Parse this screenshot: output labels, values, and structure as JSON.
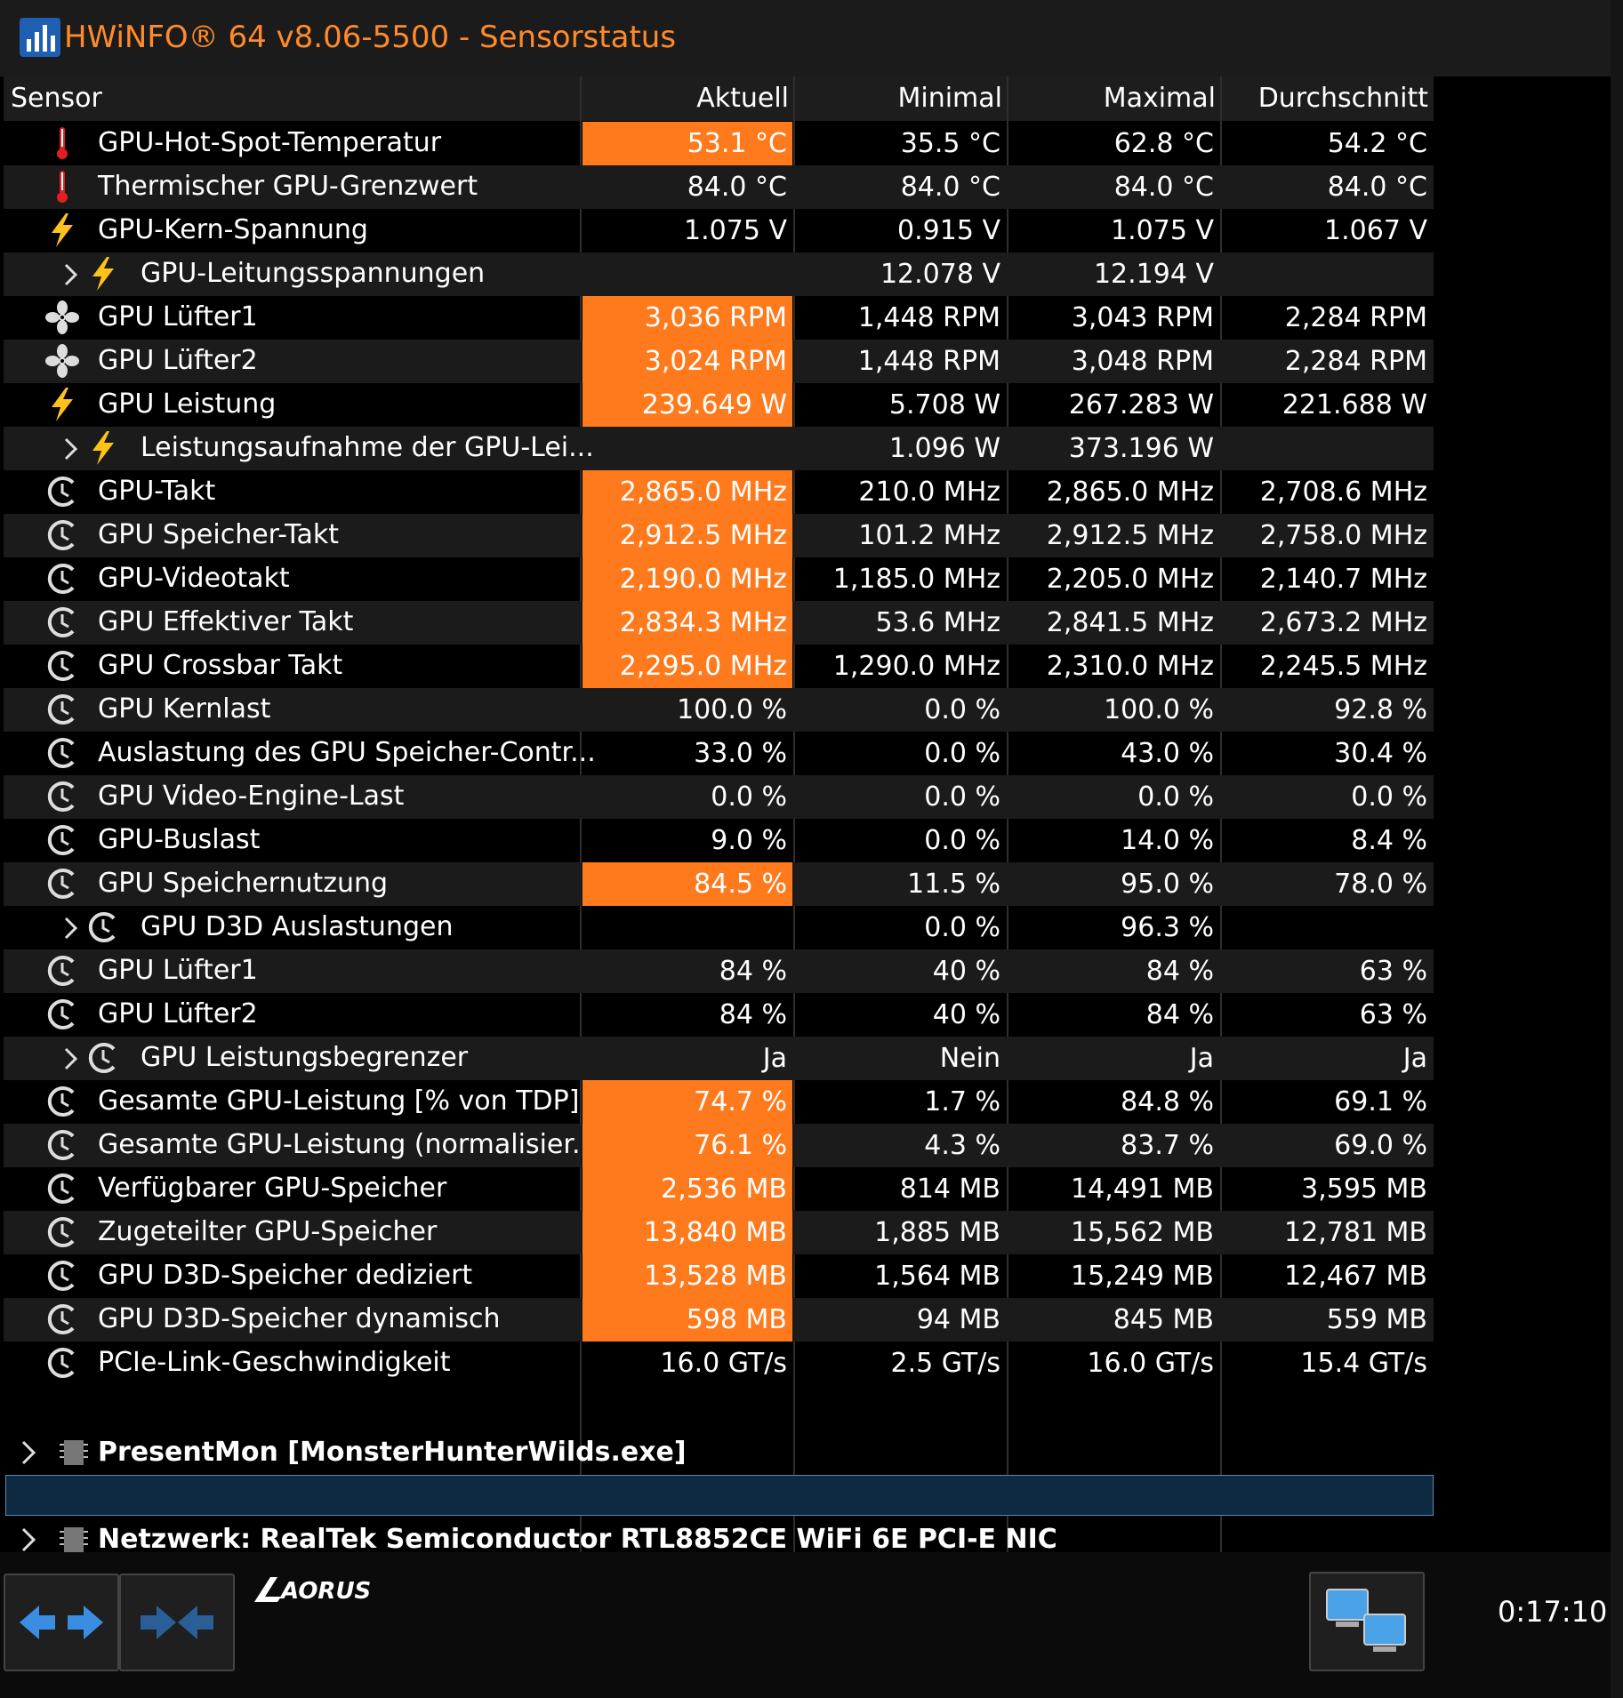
{
  "window": {
    "title": "HWiNFO® 64 v8.06-5500 - Sensorstatus"
  },
  "columns": [
    "Sensor",
    "Aktuell",
    "Minimal",
    "Maximal",
    "Durchschnitt"
  ],
  "rows": [
    {
      "icon": "thermometer-icon",
      "name": "GPU-Hot-Spot-Temperatur",
      "cur": "53.1 °C",
      "min": "35.5 °C",
      "max": "62.8 °C",
      "avg": "54.2 °C",
      "hl": true
    },
    {
      "icon": "thermometer-icon",
      "name": "Thermischer GPU-Grenzwert",
      "cur": "84.0 °C",
      "min": "84.0 °C",
      "max": "84.0 °C",
      "avg": "84.0 °C"
    },
    {
      "icon": "lightning-icon",
      "name": "GPU-Kern-Spannung",
      "cur": "1.075 V",
      "min": "0.915 V",
      "max": "1.075 V",
      "avg": "1.067 V"
    },
    {
      "icon": "lightning-icon",
      "name": "GPU-Leitungsspannungen",
      "cur": "",
      "min": "12.078 V",
      "max": "12.194 V",
      "avg": "",
      "sub": true
    },
    {
      "icon": "fan-icon",
      "name": "GPU Lüfter1",
      "cur": "3,036 RPM",
      "min": "1,448 RPM",
      "max": "3,043 RPM",
      "avg": "2,284 RPM",
      "hl": true
    },
    {
      "icon": "fan-icon",
      "name": "GPU Lüfter2",
      "cur": "3,024 RPM",
      "min": "1,448 RPM",
      "max": "3,048 RPM",
      "avg": "2,284 RPM",
      "hl": true
    },
    {
      "icon": "lightning-icon",
      "name": "GPU Leistung",
      "cur": "239.649 W",
      "min": "5.708 W",
      "max": "267.283 W",
      "avg": "221.688 W",
      "hl": true
    },
    {
      "icon": "lightning-icon",
      "name": "Leistungsaufnahme der GPU-Lei...",
      "cur": "",
      "min": "1.096 W",
      "max": "373.196 W",
      "avg": "",
      "sub": true
    },
    {
      "icon": "clock-icon",
      "name": "GPU-Takt",
      "cur": "2,865.0 MHz",
      "min": "210.0 MHz",
      "max": "2,865.0 MHz",
      "avg": "2,708.6 MHz",
      "hl": true
    },
    {
      "icon": "clock-icon",
      "name": "GPU Speicher-Takt",
      "cur": "2,912.5 MHz",
      "min": "101.2 MHz",
      "max": "2,912.5 MHz",
      "avg": "2,758.0 MHz",
      "hl": true
    },
    {
      "icon": "clock-icon",
      "name": "GPU-Videotakt",
      "cur": "2,190.0 MHz",
      "min": "1,185.0 MHz",
      "max": "2,205.0 MHz",
      "avg": "2,140.7 MHz",
      "hl": true
    },
    {
      "icon": "clock-icon",
      "name": "GPU Effektiver Takt",
      "cur": "2,834.3 MHz",
      "min": "53.6 MHz",
      "max": "2,841.5 MHz",
      "avg": "2,673.2 MHz",
      "hl": true
    },
    {
      "icon": "clock-icon",
      "name": "GPU Crossbar Takt",
      "cur": "2,295.0 MHz",
      "min": "1,290.0 MHz",
      "max": "2,310.0 MHz",
      "avg": "2,245.5 MHz",
      "hl": true
    },
    {
      "icon": "clock-icon",
      "name": "GPU Kernlast",
      "cur": "100.0 %",
      "min": "0.0 %",
      "max": "100.0 %",
      "avg": "92.8 %"
    },
    {
      "icon": "clock-icon",
      "name": "Auslastung des GPU Speicher-Contr...",
      "cur": "33.0 %",
      "min": "0.0 %",
      "max": "43.0 %",
      "avg": "30.4 %"
    },
    {
      "icon": "clock-icon",
      "name": "GPU Video-Engine-Last",
      "cur": "0.0 %",
      "min": "0.0 %",
      "max": "0.0 %",
      "avg": "0.0 %"
    },
    {
      "icon": "clock-icon",
      "name": "GPU-Buslast",
      "cur": "9.0 %",
      "min": "0.0 %",
      "max": "14.0 %",
      "avg": "8.4 %"
    },
    {
      "icon": "clock-icon",
      "name": "GPU Speichernutzung",
      "cur": "84.5 %",
      "min": "11.5 %",
      "max": "95.0 %",
      "avg": "78.0 %",
      "hl": true
    },
    {
      "icon": "clock-icon",
      "name": "GPU D3D Auslastungen",
      "cur": "",
      "min": "0.0 %",
      "max": "96.3 %",
      "avg": "",
      "sub": true
    },
    {
      "icon": "clock-icon",
      "name": "GPU Lüfter1",
      "cur": "84 %",
      "min": "40 %",
      "max": "84 %",
      "avg": "63 %"
    },
    {
      "icon": "clock-icon",
      "name": "GPU Lüfter2",
      "cur": "84 %",
      "min": "40 %",
      "max": "84 %",
      "avg": "63 %"
    },
    {
      "icon": "clock-icon",
      "name": "GPU Leistungsbegrenzer",
      "cur": "Ja",
      "min": "Nein",
      "max": "Ja",
      "avg": "Ja",
      "sub": true
    },
    {
      "icon": "clock-icon",
      "name": "Gesamte GPU-Leistung [% von TDP]",
      "cur": "74.7 %",
      "min": "1.7 %",
      "max": "84.8 %",
      "avg": "69.1 %",
      "hl": true
    },
    {
      "icon": "clock-icon",
      "name": "Gesamte GPU-Leistung (normalisier...",
      "cur": "76.1 %",
      "min": "4.3 %",
      "max": "83.7 %",
      "avg": "69.0 %",
      "hl": true
    },
    {
      "icon": "clock-icon",
      "name": "Verfügbarer GPU-Speicher",
      "cur": "2,536 MB",
      "min": "814 MB",
      "max": "14,491 MB",
      "avg": "3,595 MB",
      "hl": true
    },
    {
      "icon": "clock-icon",
      "name": "Zugeteilter GPU-Speicher",
      "cur": "13,840 MB",
      "min": "1,885 MB",
      "max": "15,562 MB",
      "avg": "12,781 MB",
      "hl": true
    },
    {
      "icon": "clock-icon",
      "name": "GPU D3D-Speicher dediziert",
      "cur": "13,528 MB",
      "min": "1,564 MB",
      "max": "15,249 MB",
      "avg": "12,467 MB",
      "hl": true
    },
    {
      "icon": "clock-icon",
      "name": "GPU D3D-Speicher dynamisch",
      "cur": "598 MB",
      "min": "94 MB",
      "max": "845 MB",
      "avg": "559 MB",
      "hl": true
    },
    {
      "icon": "clock-icon",
      "name": "PCIe-Link-Geschwindigkeit",
      "cur": "16.0 GT/s",
      "min": "2.5 GT/s",
      "max": "16.0 GT/s",
      "avg": "15.4 GT/s"
    }
  ],
  "groups": [
    {
      "name": "PresentMon [MonsterHunterWilds.exe]"
    },
    {
      "name": "Netzwerk: RealTek Semiconductor RTL8852CE WiFi 6E PCI-E NIC"
    }
  ],
  "bottombar": {
    "brand": "AORUS",
    "elapsed_time": "0:17:10"
  },
  "colors": {
    "highlight": "#ff7a1c",
    "title": "#ff8a2a",
    "background": "#000000",
    "alt_row": "#1b1b1b"
  }
}
